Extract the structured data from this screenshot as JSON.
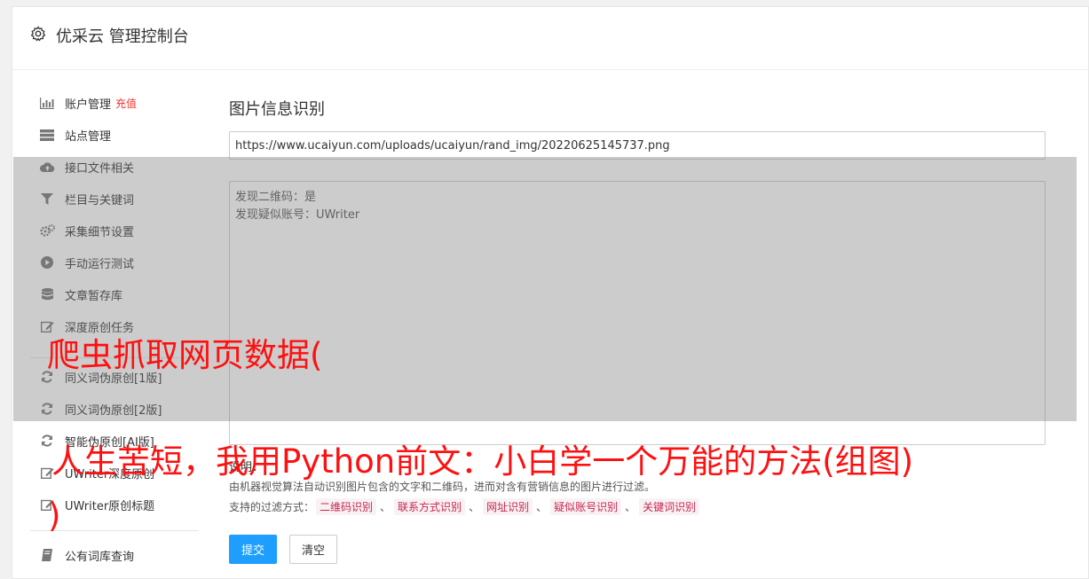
{
  "header": {
    "title": "优采云 管理控制台",
    "icon": "gear-icon"
  },
  "sidebar": {
    "items": [
      {
        "label": "账户管理",
        "badge": "充值",
        "icon": "bar-chart-icon"
      },
      {
        "label": "站点管理",
        "icon": "server-icon"
      },
      {
        "label": "接口文件相关",
        "icon": "cloud-upload-icon"
      },
      {
        "label": "栏目与关键词",
        "icon": "filter-icon"
      },
      {
        "label": "采集细节设置",
        "icon": "gears-icon"
      },
      {
        "label": "手动运行测试",
        "icon": "play-circle-icon"
      },
      {
        "label": "文章暂存库",
        "icon": "database-icon"
      },
      {
        "label": "深度原创任务",
        "icon": "edit-icon"
      },
      {
        "label": "同义词伪原创[1版]",
        "icon": "refresh-icon"
      },
      {
        "label": "同义词伪原创[2版]",
        "icon": "refresh-icon"
      },
      {
        "label": "智能伪原创[AI版]",
        "icon": "refresh-icon"
      },
      {
        "label": "UWriter深度原创",
        "icon": "edit-icon"
      },
      {
        "label": "UWriter原创标题",
        "icon": "edit-icon"
      },
      {
        "label": "公有词库查询",
        "icon": "book-icon"
      }
    ]
  },
  "main": {
    "title": "图片信息识别",
    "url_value": "https://www.ucaiyun.com/uploads/ucaiyun/rand_img/20220625145737.png",
    "results": [
      "发现二维码：是",
      "发现疑似账号：UWriter"
    ],
    "desc_label": "说明：",
    "desc_text": "由机器视觉算法自动识别图片包含的文字和二维码，进而对含有营销信息的图片进行过滤。",
    "filter_prefix": "支持的过滤方式：",
    "filter_tags": [
      "二维码识别",
      "联系方式识别",
      "网址识别",
      "疑似账号识别",
      "关键词识别"
    ],
    "filter_sep": "、",
    "submit_label": "提交",
    "clear_label": "清空"
  },
  "overlay": {
    "line1": "爬虫抓取网页数据(",
    "line2": "人生苦短，我用Python前文：小白学一个万能的方法(组图)",
    "line3": ")",
    "color": "#ff1010"
  }
}
